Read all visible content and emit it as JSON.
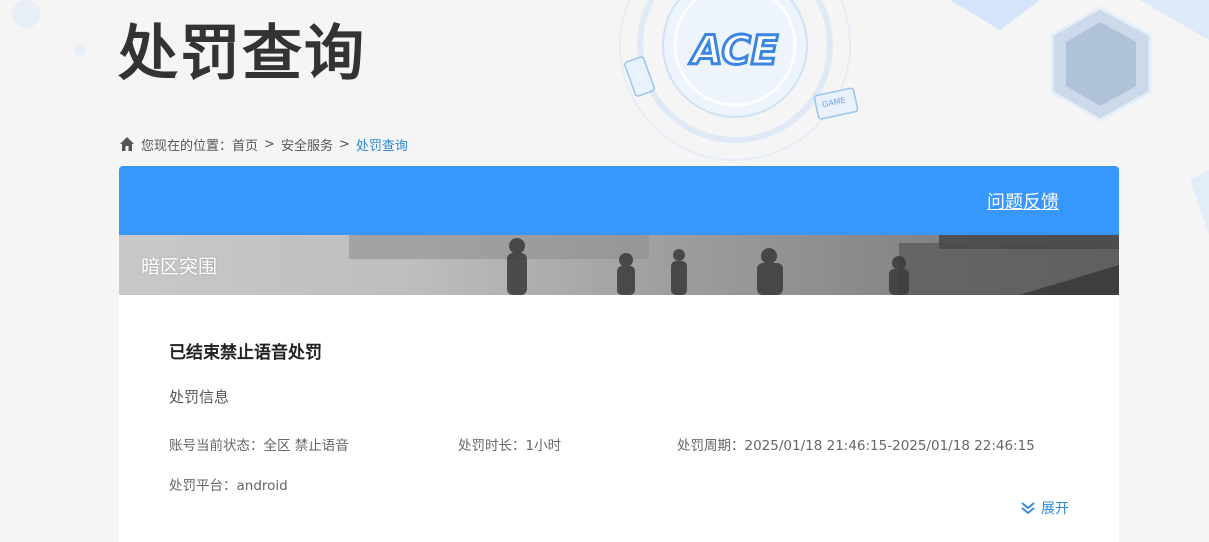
{
  "page": {
    "title": "处罚查询",
    "logo_text": "ACE",
    "logo_badge_text": "GAME"
  },
  "breadcrumb": {
    "prefix": "您现在的位置：",
    "items": [
      "首页",
      "安全服务",
      "处罚查询"
    ],
    "separator": ">"
  },
  "card": {
    "feedback_label": "问题反馈",
    "game_name": "暗区突围",
    "record": {
      "title": "已结束禁止语音处罚",
      "section_label": "处罚信息",
      "account_status": "账号当前状态：全区 禁止语音",
      "duration": "处罚时长：1小时",
      "period": "处罚周期：2025/01/18 21:46:15-2025/01/18 22:46:15",
      "platform": "处罚平台：android"
    },
    "expand_label": "展开"
  },
  "colors": {
    "accent": "#3797fd",
    "link": "#2b8ad8",
    "background": "#f5f5f5"
  },
  "icons": {
    "breadcrumb": "home-icon",
    "expand": "double-chevron-down-icon"
  }
}
